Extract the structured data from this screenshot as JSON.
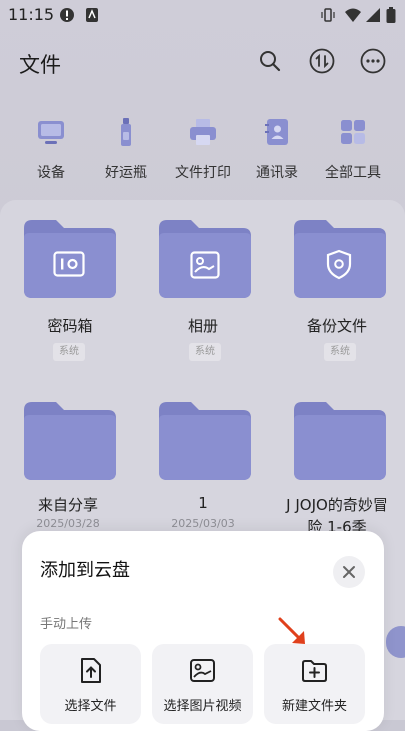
{
  "status": {
    "time": "11:15"
  },
  "header": {
    "title": "文件"
  },
  "tools": [
    {
      "label": "设备",
      "icon": "device-icon"
    },
    {
      "label": "好运瓶",
      "icon": "bottle-icon"
    },
    {
      "label": "文件打印",
      "icon": "printer-icon"
    },
    {
      "label": "通讯录",
      "icon": "contacts-icon"
    },
    {
      "label": "全部工具",
      "icon": "grid-icon"
    }
  ],
  "folders": [
    {
      "name": "密码箱",
      "tag": "系统",
      "icon": "safe-icon"
    },
    {
      "name": "相册",
      "tag": "系统",
      "icon": "photo-icon"
    },
    {
      "name": "备份文件",
      "tag": "系统",
      "icon": "shield-icon"
    },
    {
      "name": "来自分享",
      "date": "2025/03/28"
    },
    {
      "name": "1",
      "date": "2025/03/03"
    },
    {
      "name": "J JOJO的奇妙冒险 1-6季"
    }
  ],
  "sheet": {
    "title": "添加到云盘",
    "section": "手动上传",
    "options": [
      {
        "label": "选择文件"
      },
      {
        "label": "选择图片视频"
      },
      {
        "label": "新建文件夹"
      }
    ]
  },
  "colors": {
    "folder": "#8a8fd0",
    "accent": "#e0401c"
  }
}
